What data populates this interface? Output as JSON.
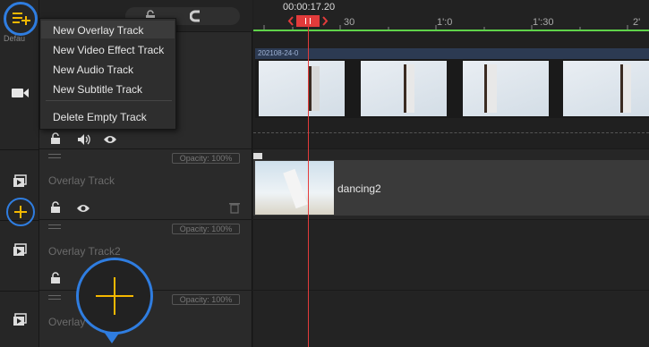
{
  "colors": {
    "accent": "#2f7de0",
    "playhead": "#e23b3b",
    "ruler_line": "#5fd34a",
    "add_icon": "#f5b800"
  },
  "ruler": {
    "timecode": "00:00:17.20",
    "labels": [
      "30",
      "1':0",
      "1':30",
      "2'"
    ]
  },
  "menu": {
    "items": [
      "New Overlay Track",
      "New Video Effect Track",
      "New Audio Track",
      "New Subtitle Track",
      "Delete Empty Track"
    ]
  },
  "tracks": {
    "main_clip_label": "202108-24-0",
    "overlay1": {
      "name": "Overlay Track",
      "opacity": "Opacity: 100%",
      "clip": "dancing2"
    },
    "overlay2": {
      "name": "Overlay Track2",
      "opacity": "Opacity: 100%"
    },
    "overlay3": {
      "name": "Overlay",
      "opacity": "Opacity: 100%"
    }
  },
  "header_partial": "Defau",
  "icons": [
    "add-track-menu-icon",
    "lock-icon",
    "magnet-icon",
    "video-icon",
    "overlay-icon",
    "add-icon",
    "audio-icon",
    "eye-icon",
    "trash-icon"
  ]
}
